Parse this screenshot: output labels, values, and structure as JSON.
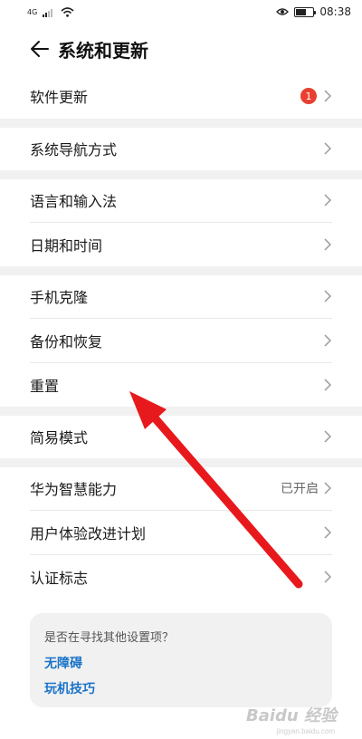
{
  "status_bar": {
    "signal_label": "4G",
    "eye_icon": "eye-comfort-icon",
    "time": "08:38"
  },
  "header": {
    "title": "系统和更新",
    "back_icon": "arrow-left-icon"
  },
  "menu": {
    "software_update": {
      "label": "软件更新",
      "badge": "1"
    },
    "system_navigation": {
      "label": "系统导航方式"
    },
    "language_input": {
      "label": "语言和输入法"
    },
    "date_time": {
      "label": "日期和时间"
    },
    "phone_clone": {
      "label": "手机克隆"
    },
    "backup_restore": {
      "label": "备份和恢复"
    },
    "reset": {
      "label": "重置"
    },
    "simple_mode": {
      "label": "简易模式"
    },
    "huawei_ai": {
      "label": "华为智慧能力",
      "value": "已开启"
    },
    "user_experience": {
      "label": "用户体验改进计划"
    },
    "certification": {
      "label": "认证标志"
    }
  },
  "suggestion_card": {
    "question": "是否在寻找其他设置项？",
    "link1": "无障碍",
    "link2": "玩机技巧"
  },
  "annotation": {
    "arrow_color": "#e8191c"
  },
  "colors": {
    "badge": "#e84030",
    "link": "#1a73c8",
    "section_gap": "#f1f1f1"
  }
}
